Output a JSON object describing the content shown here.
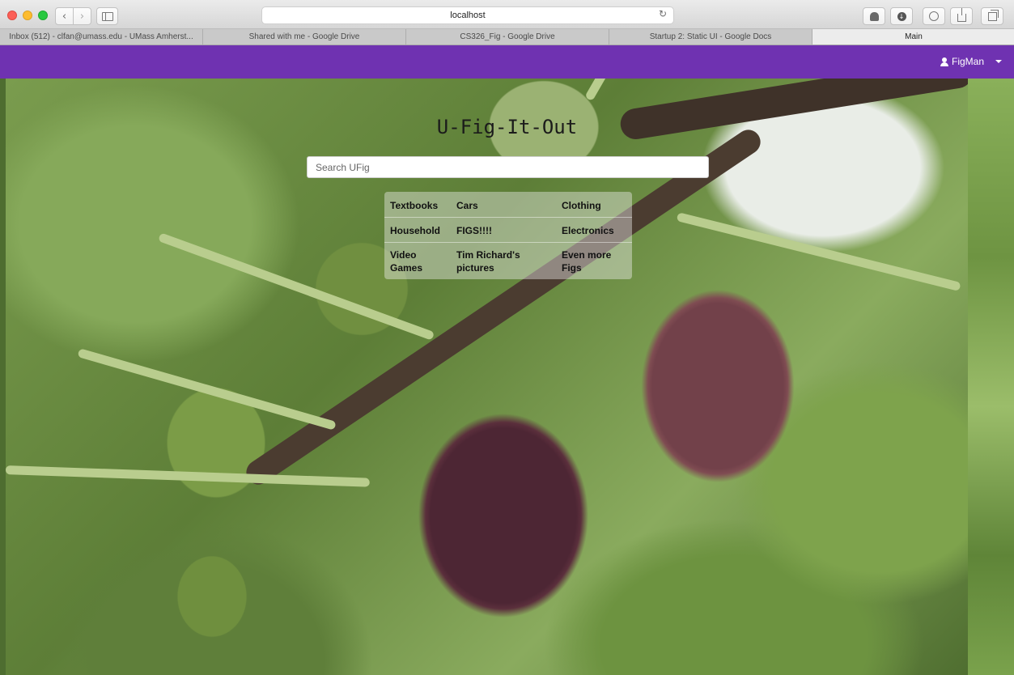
{
  "browser": {
    "url": "localhost",
    "tabs": [
      {
        "label": "Inbox (512) - clfan@umass.edu - UMass Amherst..."
      },
      {
        "label": "Shared with me - Google Drive"
      },
      {
        "label": "CS326_Fig - Google Drive"
      },
      {
        "label": "Startup 2: Static UI - Google Docs"
      },
      {
        "label": "Main"
      }
    ],
    "new_tab_label": "+",
    "back_label": "‹",
    "forward_label": "›",
    "reload_label": "↻"
  },
  "navbar": {
    "color": "#6f32b1",
    "user_name": "FigMan"
  },
  "hero": {
    "title": "U-Fig-It-Out",
    "search_placeholder": "Search UFig",
    "categories": [
      [
        "Textbooks",
        "Cars",
        "Clothing"
      ],
      [
        "Household",
        "FIGS!!!!",
        "Electronics"
      ],
      [
        "Video Games",
        "Tim Richard's pictures",
        "Even more Figs"
      ]
    ]
  }
}
